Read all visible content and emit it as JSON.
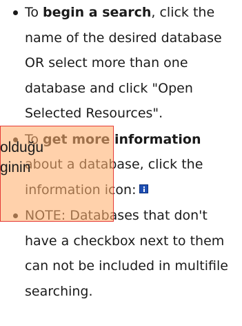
{
  "help_items": [
    {
      "prefix": "To ",
      "strong": "begin a search",
      "rest": ", click the name of the desired database OR select more than one database and click \"Open Selected Resources\"."
    },
    {
      "prefix": "To ",
      "strong": "get more information",
      "rest": " about a database, click the information icon:",
      "icon": "info-icon"
    },
    {
      "text": "NOTE: Databases that don't have a checkbox next to them can not be included in multifile searching."
    }
  ],
  "overlay": {
    "lines": [
      "olduğu",
      "ginin"
    ],
    "fill_color": "#ffb06e",
    "border_color": "#e53935"
  }
}
